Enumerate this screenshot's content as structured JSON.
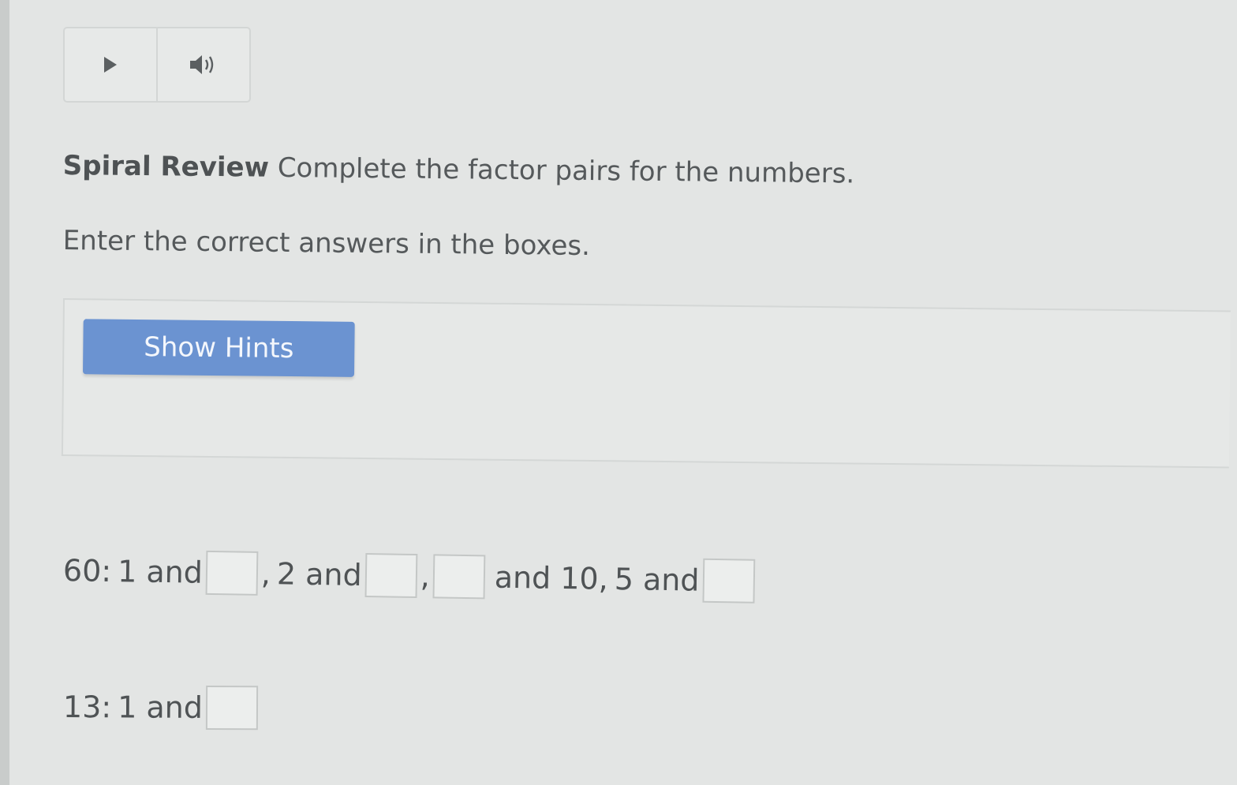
{
  "audio": {
    "play_icon": "play-icon",
    "speaker_icon": "speaker-icon"
  },
  "question": {
    "label": "Spiral Review",
    "prompt": "Complete the factor pairs for the numbers.",
    "instruction": "Enter the correct answers in the boxes."
  },
  "hints": {
    "button_label": "Show Hints",
    "button_color": "#6b93d1"
  },
  "problems": {
    "sixty": {
      "number_label": "60:",
      "pair1_text": "1 and",
      "sep1": ",",
      "pair2_text": "2 and",
      "sep2": ",",
      "pair3_text": "and 10,",
      "pair4_text": "5 and",
      "answers": [
        "",
        "",
        "",
        ""
      ]
    },
    "thirteen": {
      "number_label": "13:",
      "pair1_text": "1 and",
      "answers": [
        ""
      ]
    }
  }
}
